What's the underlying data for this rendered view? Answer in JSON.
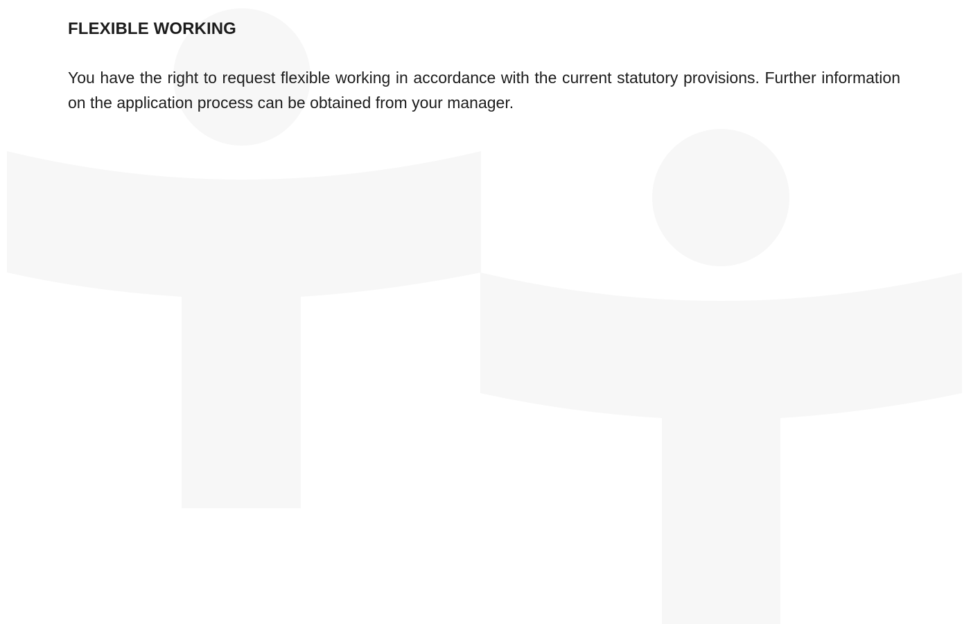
{
  "section": {
    "title": "FLEXIBLE WORKING",
    "body": "You have the right to request flexible working in accordance with the current statutory provisions. Further information on the application process can be obtained from your manager."
  },
  "watermark": {
    "icon": "person-figure-icon",
    "color": "#f7f7f7"
  }
}
